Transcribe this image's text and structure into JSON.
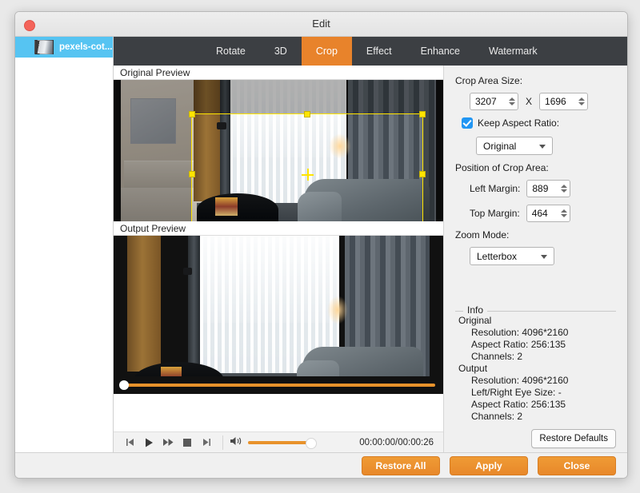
{
  "window": {
    "title": "Edit",
    "close_button": "close"
  },
  "sidebar": {
    "items": [
      {
        "label": "pexels-cot...",
        "thumb_icon": "video-thumbnail"
      }
    ]
  },
  "tabs": [
    {
      "label": "Rotate",
      "active": false
    },
    {
      "label": "3D",
      "active": false
    },
    {
      "label": "Crop",
      "active": true
    },
    {
      "label": "Effect",
      "active": false
    },
    {
      "label": "Enhance",
      "active": false
    },
    {
      "label": "Watermark",
      "active": false
    }
  ],
  "previews": {
    "original_label": "Original Preview",
    "output_label": "Output Preview"
  },
  "transport": {
    "prev_icon": "skip-previous-icon",
    "play_icon": "play-icon",
    "forward_icon": "fast-forward-icon",
    "stop_icon": "stop-icon",
    "next_icon": "skip-next-icon",
    "volume_icon": "volume-icon",
    "timecode": "00:00:00/00:00:26"
  },
  "settings": {
    "crop_area_size_label": "Crop Area Size:",
    "crop_width": "3207",
    "crop_height": "1696",
    "size_separator": "X",
    "keep_aspect_ratio_label": "Keep Aspect Ratio:",
    "keep_aspect_ratio_checked": true,
    "aspect_ratio_value": "Original",
    "position_label": "Position of Crop Area:",
    "left_margin_label": "Left Margin:",
    "left_margin_value": "889",
    "top_margin_label": "Top Margin:",
    "top_margin_value": "464",
    "zoom_mode_label": "Zoom Mode:",
    "zoom_mode_value": "Letterbox",
    "restore_defaults_label": "Restore Defaults"
  },
  "info": {
    "legend": "Info",
    "original_heading": "Original",
    "original_resolution": "Resolution: 4096*2160",
    "original_aspect": "Aspect Ratio: 256:135",
    "original_channels": "Channels: 2",
    "output_heading": "Output",
    "output_resolution": "Resolution: 4096*2160",
    "output_eye_size": "Left/Right Eye Size: -",
    "output_aspect": "Aspect Ratio: 256:135",
    "output_channels": "Channels: 2"
  },
  "footer": {
    "restore_all": "Restore All",
    "apply": "Apply",
    "close": "Close"
  },
  "colors": {
    "accent_orange": "#e8832b",
    "tabbar_dark": "#3c3f43",
    "selection_blue": "#56c4f2",
    "checkbox_blue": "#2196f3",
    "crop_outline_yellow": "#ffe400"
  }
}
